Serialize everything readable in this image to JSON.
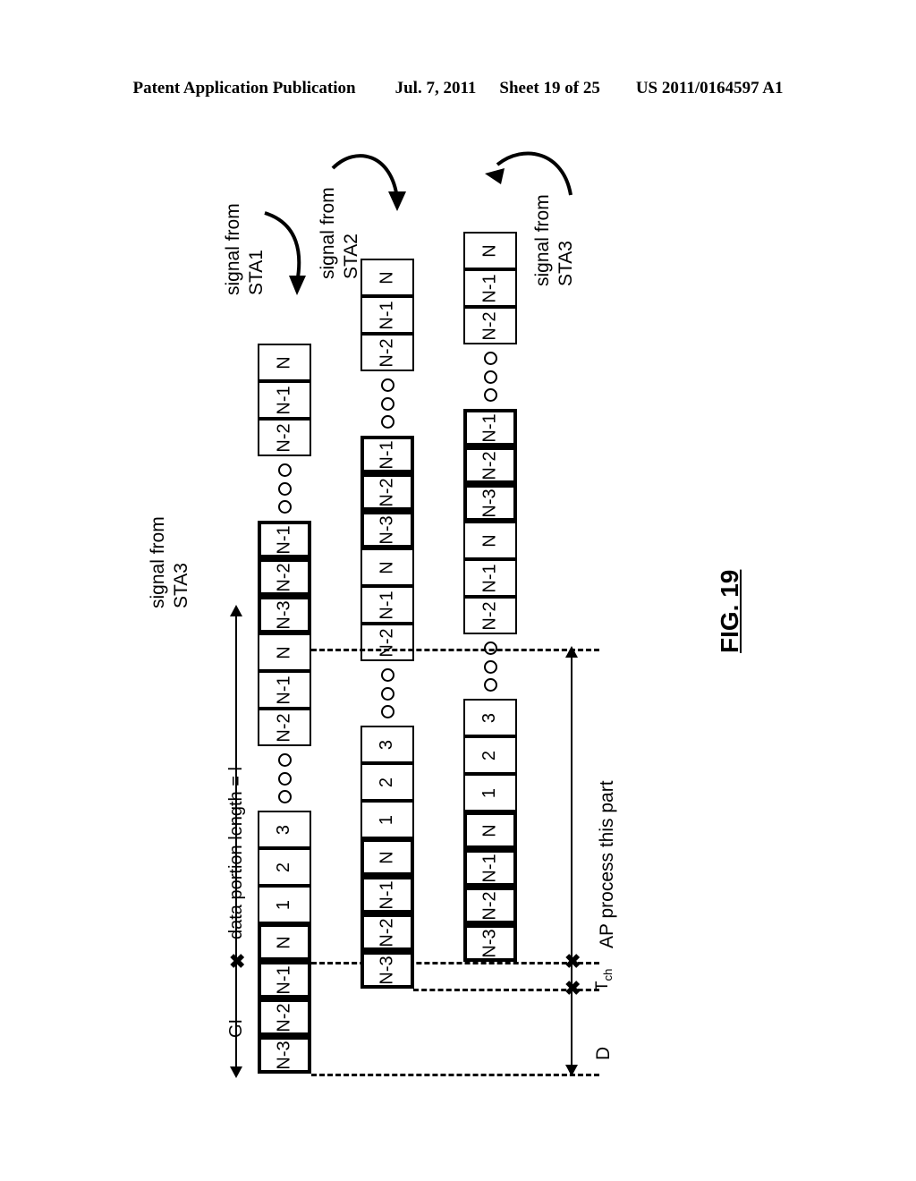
{
  "header": {
    "publication": "Patent Application Publication",
    "date": "Jul. 7, 2011",
    "sheet": "Sheet 19 of 25",
    "patent_number": "US 2011/0164597 A1"
  },
  "figure": {
    "label": "FIG. 19",
    "callouts": [
      {
        "id": "sta1",
        "line1": "signal from",
        "line2": "STA1"
      },
      {
        "id": "sta2",
        "line1": "signal from",
        "line2": "STA2"
      },
      {
        "id": "sta3_right",
        "line1": "signal from",
        "line2": "STA3"
      },
      {
        "id": "sta3_left",
        "line1": "signal from",
        "line2": "STA3"
      }
    ],
    "dimensions": {
      "gi": "GI",
      "data_portion": "data portion length = l",
      "ap_process": "AP process this part",
      "tch": "T",
      "tch_sub": "ch",
      "d": "D"
    },
    "rows": [
      {
        "name": "signal-from-sta1",
        "groups": [
          {
            "type": "cells",
            "cells": [
              {
                "label": "N-3",
                "bold": true
              },
              {
                "label": "N-2",
                "bold": true
              },
              {
                "label": "N-1",
                "bold": true
              },
              {
                "label": "N",
                "bold": true
              },
              {
                "label": "1",
                "bold": false
              },
              {
                "label": "2",
                "bold": false
              },
              {
                "label": "3",
                "bold": false
              }
            ]
          },
          {
            "type": "dots"
          },
          {
            "type": "cells",
            "cells": [
              {
                "label": "N-2",
                "bold": false
              },
              {
                "label": "N-1",
                "bold": false
              },
              {
                "label": "N",
                "bold": false
              },
              {
                "label": "N-3",
                "bold": true
              },
              {
                "label": "N-2",
                "bold": true
              },
              {
                "label": "N-1",
                "bold": true
              }
            ]
          },
          {
            "type": "dots"
          },
          {
            "type": "cells",
            "cells": [
              {
                "label": "N-2",
                "bold": false
              },
              {
                "label": "N-1",
                "bold": false
              },
              {
                "label": "N",
                "bold": false
              }
            ]
          }
        ]
      },
      {
        "name": "signal-from-sta2",
        "groups": [
          {
            "type": "cells",
            "cells": [
              {
                "label": "N-3",
                "bold": true
              },
              {
                "label": "N-2",
                "bold": true
              },
              {
                "label": "N-1",
                "bold": true
              },
              {
                "label": "N",
                "bold": true
              },
              {
                "label": "1",
                "bold": false
              },
              {
                "label": "2",
                "bold": false
              },
              {
                "label": "3",
                "bold": false
              }
            ]
          },
          {
            "type": "dots"
          },
          {
            "type": "cells",
            "cells": [
              {
                "label": "N-2",
                "bold": false
              },
              {
                "label": "N-1",
                "bold": false
              },
              {
                "label": "N",
                "bold": false
              },
              {
                "label": "N-3",
                "bold": true
              },
              {
                "label": "N-2",
                "bold": true
              },
              {
                "label": "N-1",
                "bold": true
              }
            ]
          },
          {
            "type": "dots"
          },
          {
            "type": "cells",
            "cells": [
              {
                "label": "N-2",
                "bold": false
              },
              {
                "label": "N-1",
                "bold": false
              },
              {
                "label": "N",
                "bold": false
              }
            ]
          }
        ]
      },
      {
        "name": "signal-from-sta3",
        "groups": [
          {
            "type": "cells",
            "cells": [
              {
                "label": "N-3",
                "bold": true
              },
              {
                "label": "N-2",
                "bold": true
              },
              {
                "label": "N-1",
                "bold": true
              },
              {
                "label": "N",
                "bold": true
              },
              {
                "label": "1",
                "bold": false
              },
              {
                "label": "2",
                "bold": false
              },
              {
                "label": "3",
                "bold": false
              }
            ]
          },
          {
            "type": "dots"
          },
          {
            "type": "cells",
            "cells": [
              {
                "label": "N-2",
                "bold": false
              },
              {
                "label": "N-1",
                "bold": false
              },
              {
                "label": "N",
                "bold": false
              },
              {
                "label": "N-3",
                "bold": true
              },
              {
                "label": "N-2",
                "bold": true
              },
              {
                "label": "N-1",
                "bold": true
              }
            ]
          },
          {
            "type": "dots"
          },
          {
            "type": "cells",
            "cells": [
              {
                "label": "N-2",
                "bold": false
              },
              {
                "label": "N-1",
                "bold": false
              },
              {
                "label": "N",
                "bold": false
              }
            ]
          }
        ]
      }
    ]
  }
}
